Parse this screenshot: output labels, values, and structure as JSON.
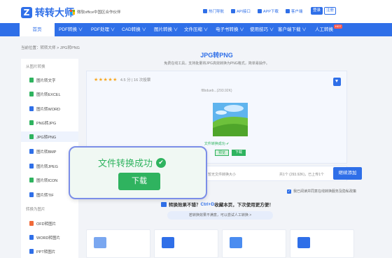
{
  "header": {
    "logo_mark": "Z",
    "logo_text": "转转大师",
    "partner_text": "微软office中国区合作伙伴",
    "links": [
      "热门导航",
      "API接口",
      "APP下载",
      "客户端"
    ],
    "login": "登录",
    "register": "注册"
  },
  "nav": {
    "home": "首页",
    "items": [
      "PDF转换 ∨",
      "PDF处理 ∨",
      "CAD转换 ∨",
      "图片转换 ∨",
      "文件压缩 ∨",
      "电子书转换 ∨",
      "使用技巧 ∨",
      "客户端下载 ∨",
      "人工转换"
    ],
    "hot_badge": "HOT",
    "accent": "#2f6fe8"
  },
  "breadcrumb": "当前位置：转转大师 > JPG转PNG",
  "sidebar": {
    "heading_1": "从图片转换",
    "items_1": [
      {
        "label": "图片转文字",
        "color": "#2fb35f"
      },
      {
        "label": "图片转EXCEL",
        "color": "#2fb35f"
      },
      {
        "label": "图片转WORD",
        "color": "#2f6fe8"
      },
      {
        "label": "PNG转JPG",
        "color": "#2fb35f"
      },
      {
        "label": "JPG转PNG",
        "color": "#2fb35f"
      },
      {
        "label": "图片转BMP",
        "color": "#2f6fe8"
      },
      {
        "label": "图片转JPEG",
        "color": "#2f6fe8"
      },
      {
        "label": "图片转ICON",
        "color": "#2fb35f"
      },
      {
        "label": "图片转TIF",
        "color": "#2f6fe8"
      }
    ],
    "heading_2": "转换为图片",
    "items_2": [
      {
        "label": "OFD转图片",
        "color": "#f06a3a"
      },
      {
        "label": "WORD转图片",
        "color": "#2f6fe8"
      },
      {
        "label": "PPT转图片",
        "color": "#2f6fe8"
      }
    ]
  },
  "main": {
    "title": "JPG转PNG",
    "subtitle": "免费在线工具，支持批量将JPG高效转换为PNG格式，简单易操作。",
    "rating_stars": "★★★★★",
    "rating_text": "4.5 分 | 16 次投票",
    "file_name": "f8bdueb...(293.92K)",
    "status": "文件转换成功 ✔",
    "preview_btn": "预览",
    "download_btn": "下载",
    "file_bar_text": "暂无文件转换大小",
    "file_count": "共1个 (293.92K)，已上传1个",
    "add_file_btn": "继续添加",
    "agree_text": "我已阅读并同意在线转换服务及隐私政策",
    "feedback_prefix": "转换效果不错？",
    "feedback_hot": "Ctrl+D",
    "feedback_suffix": "收藏本页，下次使用更方便！",
    "suggest": "若转换效果不满意，可以尝试人工转换 >"
  },
  "toast": {
    "title": "文件转换成功",
    "check": "✔",
    "download": "下载",
    "color": "#2fb35f"
  },
  "cards": [
    {
      "icon": "image-file-icon",
      "color": "#7aa7f0"
    },
    {
      "icon": "image-file-icon",
      "color": "#2f6fe8"
    },
    {
      "icon": "image-file-icon",
      "color": "#4a8cf0"
    },
    {
      "icon": "image-file-icon",
      "color": "#2f6fe8"
    }
  ]
}
